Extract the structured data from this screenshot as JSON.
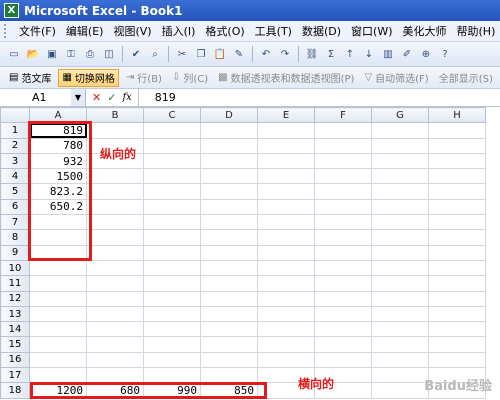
{
  "title_bar": {
    "app_icon": "excel-icon",
    "title": "Microsoft Excel - Book1"
  },
  "menu": {
    "items": [
      "文件(F)",
      "编辑(E)",
      "视图(V)",
      "插入(I)",
      "格式(O)",
      "工具(T)",
      "数据(D)",
      "窗口(W)",
      "美化大师",
      "帮助(H)"
    ]
  },
  "toolbar2": {
    "template_label": "范文库",
    "toggle_grid_label": "切换网格",
    "row_label": "行(B)",
    "col_label": "列(C)",
    "pivot_label": "数据透视表和数据透视图(P)",
    "autofilter_label": "自动筛选(F)",
    "show_all_label": "全部显示(S)"
  },
  "formula_bar": {
    "name_box": "A1",
    "cancel": "✕",
    "enter": "✓",
    "fx": "fx",
    "value": "819"
  },
  "sheet": {
    "columns": [
      "A",
      "B",
      "C",
      "D",
      "E",
      "F",
      "G",
      "H"
    ],
    "rows": [
      "1",
      "2",
      "3",
      "4",
      "5",
      "6",
      "7",
      "8",
      "9",
      "10",
      "11",
      "12",
      "13",
      "14",
      "15",
      "16",
      "17",
      "18"
    ],
    "cells": {
      "A1": "819",
      "A2": "780",
      "A3": "932",
      "A4": "1500",
      "A5": "823.2",
      "A6": "650.2",
      "A18": "1200",
      "B18": "680",
      "C18": "990",
      "D18": "850"
    }
  },
  "annotations": {
    "vertical": "纵向的",
    "horizontal": "横向的",
    "highlight_color": "#e31b1b"
  },
  "watermark": "Baidu经验"
}
